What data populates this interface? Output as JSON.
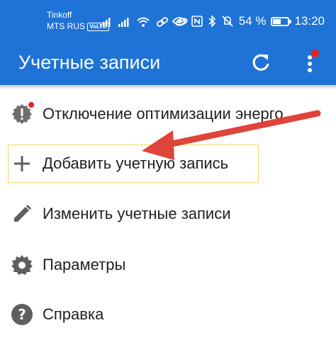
{
  "status_bar": {
    "carrier_line1": "Tinkoff",
    "carrier_line2": "MTS RUS",
    "volte": "VoLTE",
    "battery_percent": "54 %",
    "battery_level": 0.54,
    "time": "13:20"
  },
  "app_bar": {
    "title": "Учетные записи",
    "refresh_icon": "refresh-icon",
    "more_icon": "more-vert-icon"
  },
  "menu": {
    "items": [
      {
        "icon": "warning-gear-icon",
        "label": "Отключение оптимизации энерго..."
      },
      {
        "icon": "plus-icon",
        "label": "Добавить учетную запись"
      },
      {
        "icon": "pencil-icon",
        "label": "Изменить учетные записи"
      },
      {
        "icon": "gear-icon",
        "label": "Параметры"
      },
      {
        "icon": "help-icon",
        "label": "Справка"
      }
    ]
  },
  "colors": {
    "primary": "#1f73d6",
    "badge": "#e32424",
    "highlight_border": "#f2d86a",
    "annotation_arrow": "#e0433a"
  }
}
